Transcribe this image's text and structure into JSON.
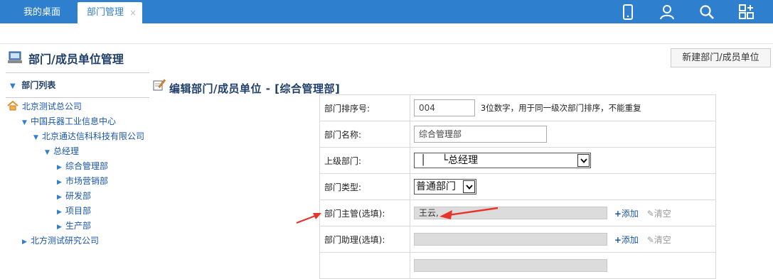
{
  "tabs": {
    "home": "我的桌面",
    "active": "部门管理",
    "close": "×"
  },
  "top_icons": [
    "mobile-icon",
    "user-icon",
    "search-icon",
    "apps-icon"
  ],
  "page": {
    "title": "部门/成员单位管理",
    "new_button": "新建部门/成员单位"
  },
  "sidebar": {
    "header": "部门列表",
    "tree": [
      {
        "label": "北京测试总公司",
        "level": 0,
        "icon": "home-icon"
      },
      {
        "label": "中国兵器工业信息中心",
        "level": 1
      },
      {
        "label": "北京通达信科科技有限公司",
        "level": 2
      },
      {
        "label": "总经理",
        "level": 3
      },
      {
        "label": "综合管理部",
        "level": 4
      },
      {
        "label": "市场营销部",
        "level": 4
      },
      {
        "label": "研发部",
        "level": 4
      },
      {
        "label": "项目部",
        "level": 4
      },
      {
        "label": "生产部",
        "level": 4
      },
      {
        "label": "北方测试研究公司",
        "level": 1
      }
    ]
  },
  "edit": {
    "title": "编辑部门/成员单位 - [综合管理部]",
    "fields": {
      "sort_label": "部门排序号:",
      "sort_value": "004",
      "sort_hint": "3位数字，用于同一级次部门排序，不能重复",
      "name_label": "部门名称:",
      "name_value": "综合管理部",
      "parent_label": "上级部门:",
      "parent_value": "│     └总经理",
      "type_label": "部门类型:",
      "type_value": "普通部门",
      "manager_label": "部门主管(选填):",
      "manager_value": "王云,",
      "assistant_label": "部门助理(选填):",
      "assistant_value": "",
      "add_label": "添加",
      "clear_label": "清空"
    }
  },
  "colors": {
    "topbar": "#2f7fcf",
    "link": "#1a56a8",
    "annotation_arrow": "#e8332b"
  }
}
